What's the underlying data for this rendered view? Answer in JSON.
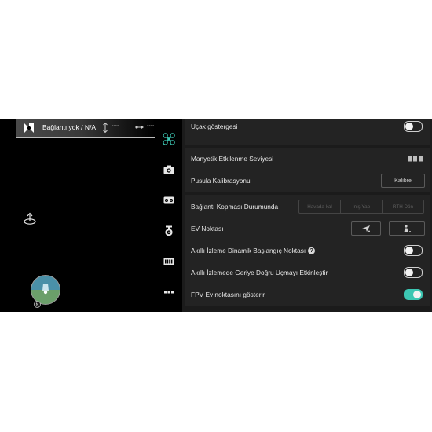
{
  "status_bar": {
    "connection": "Bağlantı yok / N/A",
    "altitude": "----",
    "distance": "----",
    "logo_icon": "dji-go-logo-icon",
    "altitude_icon": "altitude-arrow-icon",
    "distance_icon": "distance-icon"
  },
  "toolbar": {
    "items": [
      {
        "name": "aircraft",
        "icon": "drone-icon",
        "active": true
      },
      {
        "name": "camera",
        "icon": "camera-icon"
      },
      {
        "name": "remote",
        "icon": "remote-controller-icon"
      },
      {
        "name": "gimbal",
        "icon": "gimbal-icon"
      },
      {
        "name": "battery",
        "icon": "battery-icon"
      },
      {
        "name": "more",
        "icon": "more-icon"
      }
    ]
  },
  "settings": {
    "aircraft_indicator": {
      "label": "Uçak göstergesi",
      "on": false
    },
    "magnetic_interference": {
      "label": "Manyetik Etkilenme Seviyesi"
    },
    "compass_calibration": {
      "label": "Pusula Kalibrasyonu",
      "button": "Kalibre"
    },
    "lost_connection": {
      "label": "Bağlantı Kopması Durumunda",
      "options": [
        "Havada kal",
        "İniş Yap",
        "RTH Dön"
      ]
    },
    "home_point": {
      "label": "EV Noktası"
    },
    "dynamic_home": {
      "label": "Akıllı İzleme Dinamik Başlangıç Noktası",
      "help": "?",
      "on": false
    },
    "backward_flight": {
      "label": "Akıllı İzlemede Geriye Doğru Uçmayı Etkinleştir",
      "on": false
    },
    "fpv_home": {
      "label": "FPV Ev noktasını gösterir",
      "on": true
    }
  },
  "colors": {
    "accent": "#3cc6b2",
    "panel": "#1b1b1b",
    "row": "#232323"
  }
}
